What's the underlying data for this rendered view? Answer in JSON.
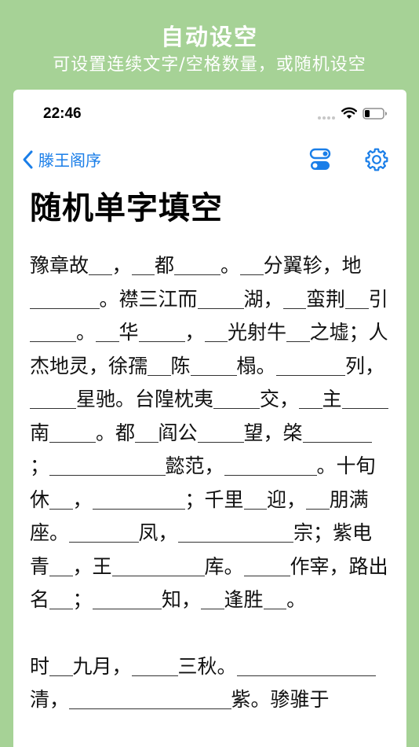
{
  "promo": {
    "title": "自动设空",
    "subtitle": "可设置连续文字/空格数量，或随机设空"
  },
  "status": {
    "time": "22:46"
  },
  "nav": {
    "back_label": "滕王阁序"
  },
  "page": {
    "title": "随机单字填空"
  },
  "paragraphs": [
    [
      {
        "t": "豫章故"
      },
      {
        "b": 1
      },
      {
        "t": "，"
      },
      {
        "b": 1
      },
      {
        "t": "都"
      },
      {
        "b": 2
      },
      {
        "t": "。"
      },
      {
        "b": 1
      },
      {
        "t": "分翼轸，"
      },
      {
        "t": "地"
      },
      {
        "b": 3
      },
      {
        "t": "。襟三江而"
      },
      {
        "b": 2
      },
      {
        "t": "湖，"
      },
      {
        "b": 1
      },
      {
        "t": "蛮"
      },
      {
        "t": "荆"
      },
      {
        "b": 1
      },
      {
        "t": "引"
      },
      {
        "b": 2
      },
      {
        "t": "。"
      },
      {
        "b": 1
      },
      {
        "t": "华"
      },
      {
        "b": 2
      },
      {
        "t": "，"
      },
      {
        "b": 1
      },
      {
        "t": "光射牛"
      },
      {
        "b": 1
      },
      {
        "t": "之墟；人杰地灵，徐孺"
      },
      {
        "b": 1
      },
      {
        "t": "陈"
      },
      {
        "b": 2
      },
      {
        "t": "榻。"
      },
      {
        "b": 3
      },
      {
        "t": "列，"
      },
      {
        "b": 2
      },
      {
        "t": "星驰。台隍枕"
      },
      {
        "t": "夷"
      },
      {
        "b": 2
      },
      {
        "t": "交，"
      },
      {
        "b": 1
      },
      {
        "t": "主"
      },
      {
        "b": 2
      },
      {
        "t": "南"
      },
      {
        "b": 2
      },
      {
        "t": "。都"
      },
      {
        "b": 1
      },
      {
        "t": "阎公"
      },
      {
        "b": 2
      },
      {
        "t": "望，棨"
      },
      {
        "b": 3
      },
      {
        "t": "；"
      },
      {
        "b": 4
      },
      {
        "b": 1
      },
      {
        "t": "懿范，"
      },
      {
        "b": 4
      },
      {
        "t": "。十旬休"
      },
      {
        "b": 1
      },
      {
        "t": "，"
      },
      {
        "b": 1
      },
      {
        "b": 3
      },
      {
        "t": "；千里"
      },
      {
        "b": 1
      },
      {
        "t": "迎，"
      },
      {
        "b": 1
      },
      {
        "t": "朋满座。"
      },
      {
        "b": 1
      },
      {
        "b": 2
      },
      {
        "t": "凤，"
      },
      {
        "b": 5
      },
      {
        "t": "宗；紫电青"
      },
      {
        "b": 1
      },
      {
        "t": "，王"
      },
      {
        "b": 4
      },
      {
        "t": "库。"
      },
      {
        "b": 2
      },
      {
        "t": "作宰，路"
      },
      {
        "t": "出名"
      },
      {
        "b": 1
      },
      {
        "t": "；"
      },
      {
        "b": 3
      },
      {
        "t": "知，"
      },
      {
        "b": 1
      },
      {
        "t": "逢胜"
      },
      {
        "b": 1
      },
      {
        "t": "。"
      }
    ],
    [
      {
        "t": "时"
      },
      {
        "b": 1
      },
      {
        "t": "九月，"
      },
      {
        "b": 2
      },
      {
        "t": "三秋。"
      },
      {
        "b": 5
      },
      {
        "b": 1
      },
      {
        "t": "清，"
      },
      {
        "b": 7
      },
      {
        "t": "紫。"
      },
      {
        "t": "骖骓于"
      }
    ]
  ],
  "icons": {
    "back": "chevron-left-icon",
    "toggle": "toggle-settings-icon",
    "gear": "gear-icon",
    "wifi": "wifi-icon",
    "battery": "battery-icon"
  },
  "colors": {
    "background": "#a6d296",
    "accent": "#1a7ee8"
  }
}
